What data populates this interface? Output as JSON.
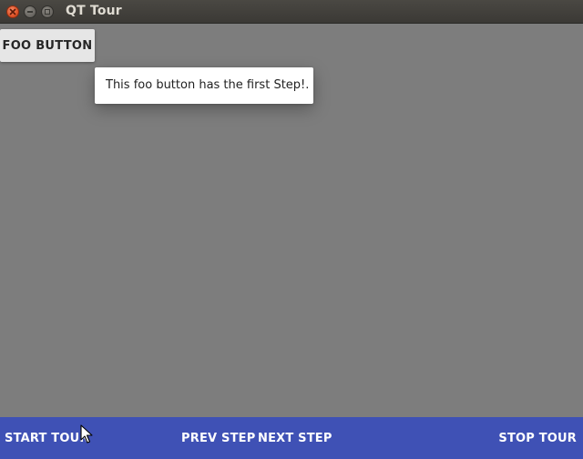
{
  "window": {
    "title": "QT Tour",
    "controls": [
      "close-icon",
      "minimize-icon",
      "maximize-icon"
    ]
  },
  "main": {
    "foo_button_label": "FOO BUTTON",
    "tooltip_text": "This foo button has the first Step!."
  },
  "tour_bar": {
    "start_label": "START TOUR",
    "prev_label": "PREV STEP",
    "next_label": "NEXT STEP",
    "stop_label": "STOP TOUR"
  },
  "colors": {
    "titlebar": "#3f3d39",
    "workspace": "#7d7d7d",
    "tour_bar": "#3f51b5",
    "close_button": "#e05429",
    "foo_button": "#e6e6e6",
    "tooltip": "#ffffff"
  }
}
